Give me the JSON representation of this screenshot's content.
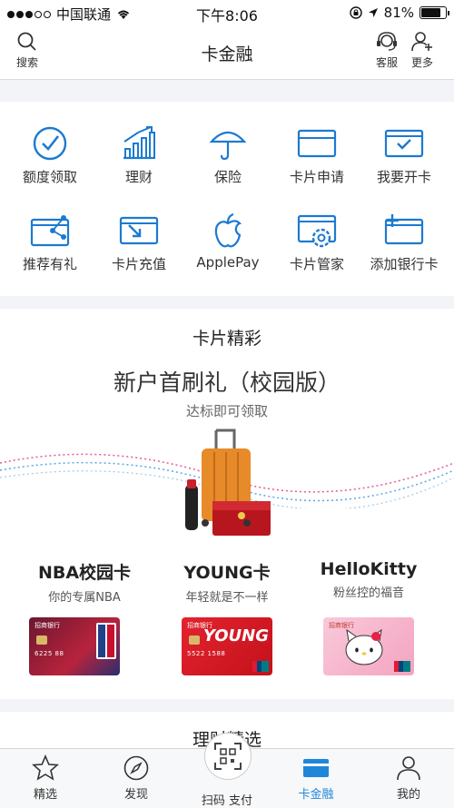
{
  "status_bar": {
    "carrier": "中国联通",
    "time": "下午8:06",
    "battery": "81%",
    "battery_level": 0.81
  },
  "nav": {
    "search_label": "搜索",
    "title": "卡金融",
    "service_label": "客服",
    "more_label": "更多"
  },
  "services": [
    {
      "label": "额度领取",
      "icon": "check-circle-icon"
    },
    {
      "label": "理财",
      "icon": "bar-chart-icon"
    },
    {
      "label": "保险",
      "icon": "umbrella-icon"
    },
    {
      "label": "卡片申请",
      "icon": "card-icon"
    },
    {
      "label": "我要开卡",
      "icon": "card-check-icon"
    },
    {
      "label": "推荐有礼",
      "icon": "card-share-icon"
    },
    {
      "label": "卡片充值",
      "icon": "card-arrow-icon"
    },
    {
      "label": "ApplePay",
      "icon": "apple-icon"
    },
    {
      "label": "卡片管家",
      "icon": "card-gear-icon"
    },
    {
      "label": "添加银行卡",
      "icon": "card-plus-icon"
    }
  ],
  "promo": {
    "section_title": "卡片精彩",
    "headline": "新户首刷礼（校园版）",
    "subline": "达标即可领取",
    "cards": [
      {
        "name": "NBA校园卡",
        "desc": "你的专属NBA",
        "bank_logo_text": "招商银行",
        "card_number": "6225 88"
      },
      {
        "name": "YOUNG卡",
        "desc": "年轻就是不一样",
        "bank_logo_text": "招商银行",
        "card_number": "5522 1588"
      },
      {
        "name": "HelloKitty",
        "desc": "粉丝控的福音",
        "bank_logo_text": "招商银行",
        "card_number": ""
      }
    ]
  },
  "next_section": {
    "title": "理财精选"
  },
  "tab_bar": {
    "tabs": [
      {
        "label": "精选",
        "icon": "star-icon"
      },
      {
        "label": "发现",
        "icon": "compass-icon"
      },
      {
        "label": "扫码 支付",
        "icon": "scan-icon"
      },
      {
        "label": "卡金融",
        "icon": "card-icon",
        "active": true
      },
      {
        "label": "我的",
        "icon": "person-icon"
      }
    ]
  },
  "colors": {
    "accent": "#1f86d8",
    "icon_blue": "#1c7ad1"
  }
}
